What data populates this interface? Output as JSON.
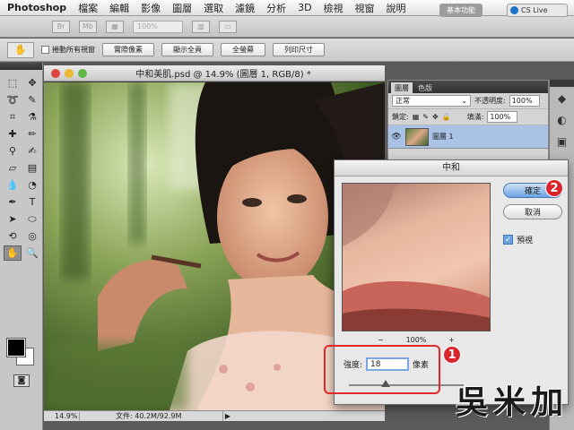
{
  "menubar": {
    "app_name": "Photoshop",
    "items": [
      "檔案",
      "編輯",
      "影像",
      "圖層",
      "選取",
      "濾鏡",
      "分析",
      "3D",
      "檢視",
      "視窗",
      "說明"
    ]
  },
  "appbar": {
    "zoom_value": "100%",
    "workspace_button": "基本功能",
    "cslive_label": "CS Live"
  },
  "options_bar": {
    "scroll_all_windows": "捲動所有視窗",
    "buttons": [
      "實際像素",
      "顯示全頁",
      "全螢幕",
      "列印尺寸"
    ]
  },
  "document": {
    "title": "中和美肌.psd @ 14.9% (圖層 1, RGB/8) *",
    "status_zoom": "14.9%",
    "status_file": "文件: 40.2M/92.9M"
  },
  "layers_panel": {
    "tabs": [
      "圖層",
      "色版"
    ],
    "blend_mode": "正常",
    "opacity_label": "不透明度:",
    "opacity_value": "100%",
    "lock_label": "鎖定:",
    "fill_label": "填滿:",
    "fill_value": "100%",
    "layer_name": "圖層 1"
  },
  "dialog": {
    "title": "中和",
    "ok_label": "確定",
    "cancel_label": "取消",
    "preview_label": "預視",
    "zoom_minus": "−",
    "zoom_value": "100%",
    "zoom_plus": "+",
    "strength_label": "強度:",
    "strength_value": "18",
    "strength_unit": "像素"
  },
  "annotations": {
    "badge_1": "1",
    "badge_2": "2",
    "watermark": "吳米加"
  },
  "colors": {
    "accent_blue": "#6ba3e3",
    "annotation_red": "#e32a2a",
    "selected_layer": "#a9c2e6"
  }
}
